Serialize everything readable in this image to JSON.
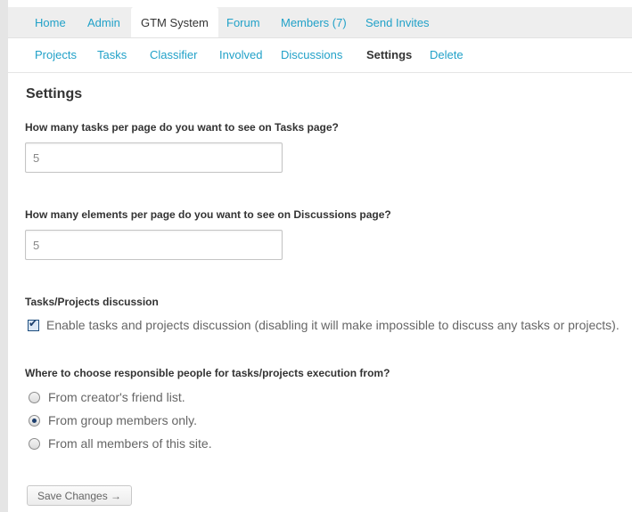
{
  "top_nav": [
    {
      "label": "Home"
    },
    {
      "label": "Admin"
    },
    {
      "label": "GTM System"
    },
    {
      "label": "Forum"
    },
    {
      "label": "Members (7)"
    },
    {
      "label": "Send Invites"
    }
  ],
  "sub_nav": [
    {
      "label": "Projects"
    },
    {
      "label": "Tasks"
    },
    {
      "label": "Classifier"
    },
    {
      "label": "Involved"
    },
    {
      "label": "Discussions"
    },
    {
      "label": "Settings"
    },
    {
      "label": "Delete"
    }
  ],
  "page_title": "Settings",
  "tasks_per_page": {
    "label": "How many tasks per page do you want to see on Tasks page?",
    "value": "5"
  },
  "discussions_per_page": {
    "label": "How many elements per page do you want to see on Discussions page?",
    "value": "5"
  },
  "discussion_section": {
    "label": "Tasks/Projects discussion",
    "checkbox_label": "Enable tasks and projects discussion (disabling it will make impossible to discuss any tasks or projects).",
    "checked": true
  },
  "responsible_section": {
    "label": "Where to choose responsible people for tasks/projects execution from?",
    "options": [
      {
        "label": "From creator's friend list.",
        "selected": false
      },
      {
        "label": "From group members only.",
        "selected": true
      },
      {
        "label": "From all members of this site.",
        "selected": false
      }
    ]
  },
  "save_button": "Save Changes →"
}
